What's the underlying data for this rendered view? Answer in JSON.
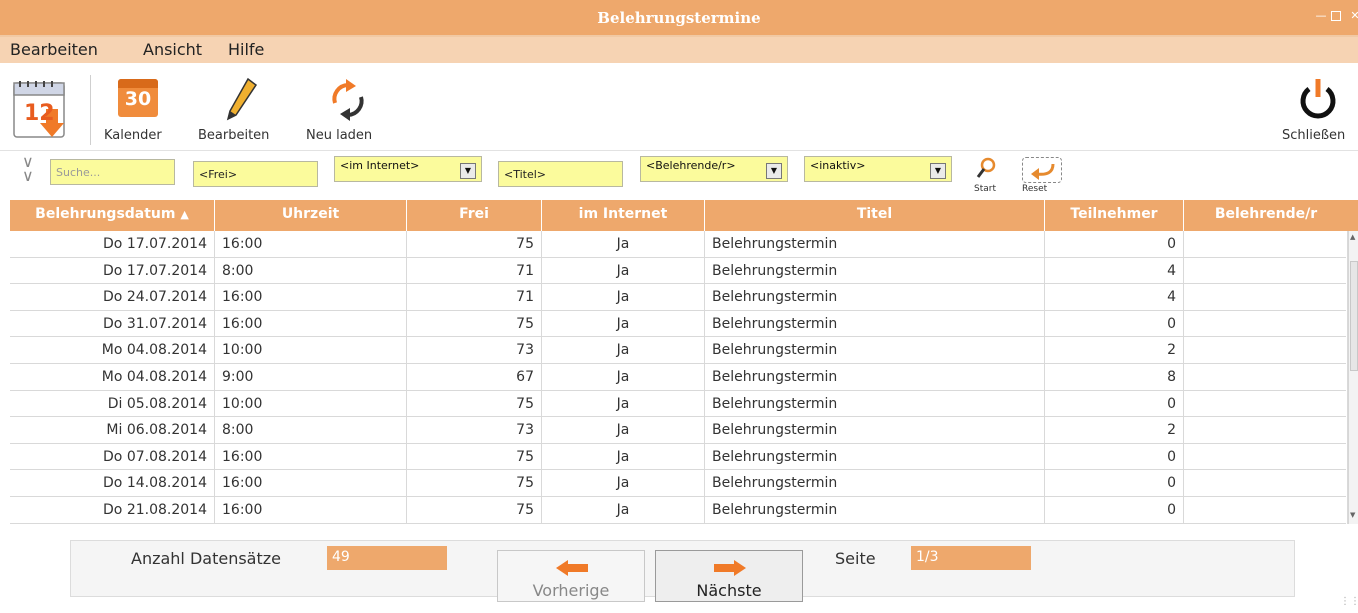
{
  "window": {
    "title": "Belehrungstermine"
  },
  "menu": [
    "Bearbeiten",
    "Ansicht",
    "Hilfe"
  ],
  "toolbar": {
    "calendar_label": "Kalender",
    "calendar_day": "30",
    "calendar_big_day": "12",
    "edit_label": "Bearbeiten",
    "reload_label": "Neu laden",
    "close_label": "Schließen"
  },
  "filters": {
    "search_placeholder": "Suche...",
    "frei": "<Frei>",
    "internet": "<im Internet>",
    "titel": "<Titel>",
    "belehrende": "<Belehrende/r>",
    "inaktiv": "<inaktiv>",
    "start_label": "Start",
    "reset_label": "Reset"
  },
  "table": {
    "columns": [
      "Belehrungsdatum",
      "Uhrzeit",
      "Frei",
      "im Internet",
      "Titel",
      "Teilnehmer",
      "Belehrende/r"
    ],
    "rows": [
      {
        "datum": "Do 17.07.2014",
        "uhrzeit": "16:00",
        "frei": "75",
        "internet": "Ja",
        "titel": "Belehrungstermin",
        "teilnehmer": "0",
        "belehrende": ""
      },
      {
        "datum": "Do 17.07.2014",
        "uhrzeit": "8:00",
        "frei": "71",
        "internet": "Ja",
        "titel": "Belehrungstermin",
        "teilnehmer": "4",
        "belehrende": ""
      },
      {
        "datum": "Do 24.07.2014",
        "uhrzeit": "16:00",
        "frei": "71",
        "internet": "Ja",
        "titel": "Belehrungstermin",
        "teilnehmer": "4",
        "belehrende": ""
      },
      {
        "datum": "Do 31.07.2014",
        "uhrzeit": "16:00",
        "frei": "75",
        "internet": "Ja",
        "titel": "Belehrungstermin",
        "teilnehmer": "0",
        "belehrende": ""
      },
      {
        "datum": "Mo 04.08.2014",
        "uhrzeit": "10:00",
        "frei": "73",
        "internet": "Ja",
        "titel": "Belehrungstermin",
        "teilnehmer": "2",
        "belehrende": ""
      },
      {
        "datum": "Mo 04.08.2014",
        "uhrzeit": "9:00",
        "frei": "67",
        "internet": "Ja",
        "titel": "Belehrungstermin",
        "teilnehmer": "8",
        "belehrende": ""
      },
      {
        "datum": "Di 05.08.2014",
        "uhrzeit": "10:00",
        "frei": "75",
        "internet": "Ja",
        "titel": "Belehrungstermin",
        "teilnehmer": "0",
        "belehrende": ""
      },
      {
        "datum": "Mi 06.08.2014",
        "uhrzeit": "8:00",
        "frei": "73",
        "internet": "Ja",
        "titel": "Belehrungstermin",
        "teilnehmer": "2",
        "belehrende": ""
      },
      {
        "datum": "Do 07.08.2014",
        "uhrzeit": "16:00",
        "frei": "75",
        "internet": "Ja",
        "titel": "Belehrungstermin",
        "teilnehmer": "0",
        "belehrende": ""
      },
      {
        "datum": "Do 14.08.2014",
        "uhrzeit": "16:00",
        "frei": "75",
        "internet": "Ja",
        "titel": "Belehrungstermin",
        "teilnehmer": "0",
        "belehrende": ""
      },
      {
        "datum": "Do 21.08.2014",
        "uhrzeit": "16:00",
        "frei": "75",
        "internet": "Ja",
        "titel": "Belehrungstermin",
        "teilnehmer": "0",
        "belehrende": ""
      }
    ]
  },
  "footer": {
    "count_label": "Anzahl Datensätze",
    "count_value": "49",
    "prev_label": "Vorherige",
    "next_label": "Nächste",
    "page_label": "Seite",
    "page_value": "1/3"
  },
  "colors": {
    "accent": "#eea86c",
    "menu_bg": "#f6d3b3",
    "filter_bg": "#fbfb9c"
  }
}
